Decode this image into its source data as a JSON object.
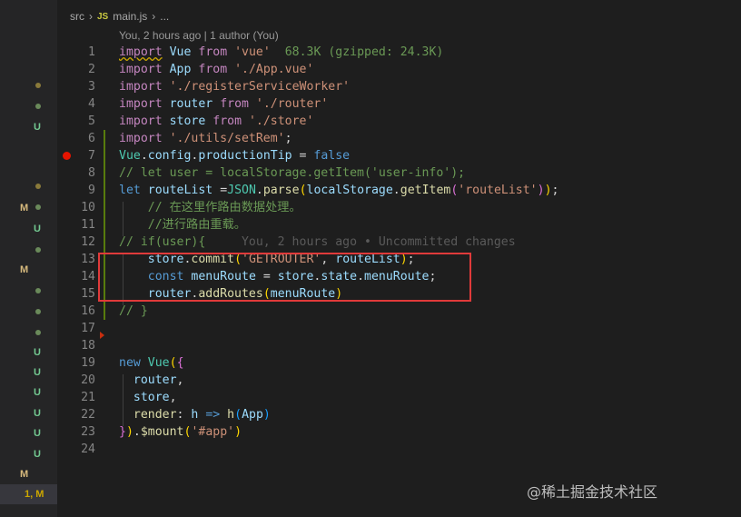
{
  "breadcrumb": {
    "folder": "src",
    "file_badge": "JS",
    "file": "main.js",
    "more": "..."
  },
  "codelens": "You, 2 hours ago | 1 author (You)",
  "watermark": "@稀土掘金技术社区",
  "scm_markers": [
    {
      "label": "",
      "kind": "dot",
      "color": "#8a7a3a"
    },
    {
      "label": "",
      "kind": "dot",
      "color": "#6a8a5a"
    },
    {
      "label": "U",
      "kind": "U"
    },
    {
      "label": "",
      "kind": "dot",
      "color": "#8a7a3a"
    },
    {
      "label": "",
      "kind": "dot",
      "color": "#6a8a5a"
    },
    {
      "label": "M",
      "kind": "M"
    },
    {
      "label": "U",
      "kind": "U"
    },
    {
      "label": "",
      "kind": "dot",
      "color": "#6a8a5a"
    },
    {
      "label": "M",
      "kind": "M"
    },
    {
      "label": "",
      "kind": "dot",
      "color": "#6a8a5a"
    },
    {
      "label": "",
      "kind": "dot",
      "color": "#6a8a5a"
    },
    {
      "label": "",
      "kind": "dot",
      "color": "#6a8a5a"
    },
    {
      "label": "U",
      "kind": "U"
    },
    {
      "label": "U",
      "kind": "U"
    },
    {
      "label": "U",
      "kind": "U"
    },
    {
      "label": "U",
      "kind": "U"
    },
    {
      "label": "U",
      "kind": "U"
    },
    {
      "label": "U",
      "kind": "U"
    },
    {
      "label": "M",
      "kind": "M"
    },
    {
      "label": "1, M",
      "kind": "warn"
    }
  ],
  "lines": [
    {
      "n": "1",
      "tokens": [
        [
          "kw2 squig",
          "import"
        ],
        [
          "punc",
          " "
        ],
        [
          "id",
          "Vue"
        ],
        [
          "punc",
          " "
        ],
        [
          "kw2",
          "from"
        ],
        [
          "punc",
          " "
        ],
        [
          "str",
          "'vue'"
        ],
        [
          "punc",
          "  "
        ],
        [
          "size",
          "68.3K (gzipped: 24.3K)"
        ]
      ]
    },
    {
      "n": "2",
      "tokens": [
        [
          "kw2",
          "import"
        ],
        [
          "punc",
          " "
        ],
        [
          "id",
          "App"
        ],
        [
          "punc",
          " "
        ],
        [
          "kw2",
          "from"
        ],
        [
          "punc",
          " "
        ],
        [
          "str",
          "'./App.vue'"
        ]
      ]
    },
    {
      "n": "3",
      "tokens": [
        [
          "kw2",
          "import"
        ],
        [
          "punc",
          " "
        ],
        [
          "str",
          "'./registerServiceWorker'"
        ]
      ]
    },
    {
      "n": "4",
      "tokens": [
        [
          "kw2",
          "import"
        ],
        [
          "punc",
          " "
        ],
        [
          "id",
          "router"
        ],
        [
          "punc",
          " "
        ],
        [
          "kw2",
          "from"
        ],
        [
          "punc",
          " "
        ],
        [
          "str",
          "'./router'"
        ]
      ]
    },
    {
      "n": "5",
      "tokens": [
        [
          "kw2",
          "import"
        ],
        [
          "punc",
          " "
        ],
        [
          "id",
          "store"
        ],
        [
          "punc",
          " "
        ],
        [
          "kw2",
          "from"
        ],
        [
          "punc",
          " "
        ],
        [
          "str",
          "'./store'"
        ]
      ]
    },
    {
      "n": "6",
      "tokens": [
        [
          "kw2",
          "import"
        ],
        [
          "punc",
          " "
        ],
        [
          "str",
          "'./utils/setRem'"
        ],
        [
          "punc",
          ";"
        ]
      ]
    },
    {
      "n": "7",
      "tokens": [
        [
          "cls",
          "Vue"
        ],
        [
          "punc",
          "."
        ],
        [
          "id",
          "config"
        ],
        [
          "punc",
          "."
        ],
        [
          "id",
          "productionTip"
        ],
        [
          "punc",
          " = "
        ],
        [
          "kw",
          "false"
        ]
      ]
    },
    {
      "n": "8",
      "tokens": [
        [
          "cmt",
          "// let user = localStorage.getItem('user-info');"
        ]
      ]
    },
    {
      "n": "9",
      "tokens": [
        [
          "kw",
          "let"
        ],
        [
          "punc",
          " "
        ],
        [
          "id",
          "routeList"
        ],
        [
          "punc",
          " ="
        ],
        [
          "cls",
          "JSON"
        ],
        [
          "punc",
          "."
        ],
        [
          "fn",
          "parse"
        ],
        [
          "br",
          "("
        ],
        [
          "id",
          "localStorage"
        ],
        [
          "punc",
          "."
        ],
        [
          "fn",
          "getItem"
        ],
        [
          "br2",
          "("
        ],
        [
          "str",
          "'routeList'"
        ],
        [
          "br2",
          ")"
        ],
        [
          "br",
          ")"
        ],
        [
          "punc",
          ";"
        ]
      ]
    },
    {
      "n": "10",
      "tokens": [
        [
          "punc",
          "    "
        ],
        [
          "cmt",
          "// 在这里作路由数据处理。"
        ]
      ]
    },
    {
      "n": "11",
      "tokens": [
        [
          "punc",
          "    "
        ],
        [
          "cmt",
          "//进行路由重载。"
        ]
      ]
    },
    {
      "n": "12",
      "tokens": [
        [
          "cmt",
          "// if(user){"
        ],
        [
          "punc",
          "     "
        ],
        [
          "blame",
          "You, 2 hours ago • Uncommitted changes"
        ]
      ]
    },
    {
      "n": "13",
      "tokens": [
        [
          "punc",
          "    "
        ],
        [
          "id",
          "store"
        ],
        [
          "punc",
          "."
        ],
        [
          "fn",
          "commit"
        ],
        [
          "br",
          "("
        ],
        [
          "str",
          "'GETROUTER'"
        ],
        [
          "punc",
          ", "
        ],
        [
          "id",
          "routeList"
        ],
        [
          "br",
          ")"
        ],
        [
          "punc",
          ";"
        ]
      ]
    },
    {
      "n": "14",
      "tokens": [
        [
          "punc",
          "    "
        ],
        [
          "kw",
          "const"
        ],
        [
          "punc",
          " "
        ],
        [
          "id",
          "menuRoute"
        ],
        [
          "punc",
          " = "
        ],
        [
          "id",
          "store"
        ],
        [
          "punc",
          "."
        ],
        [
          "id",
          "state"
        ],
        [
          "punc",
          "."
        ],
        [
          "id",
          "menuRoute"
        ],
        [
          "punc",
          ";"
        ]
      ]
    },
    {
      "n": "15",
      "tokens": [
        [
          "punc",
          "    "
        ],
        [
          "id",
          "router"
        ],
        [
          "punc",
          "."
        ],
        [
          "fn",
          "addRoutes"
        ],
        [
          "br",
          "("
        ],
        [
          "id",
          "menuRoute"
        ],
        [
          "br",
          ")"
        ]
      ]
    },
    {
      "n": "16",
      "tokens": [
        [
          "cmt",
          "// }"
        ]
      ]
    },
    {
      "n": "17",
      "tokens": []
    },
    {
      "n": "18",
      "tokens": []
    },
    {
      "n": "19",
      "tokens": [
        [
          "kw",
          "new"
        ],
        [
          "punc",
          " "
        ],
        [
          "cls",
          "Vue"
        ],
        [
          "br",
          "("
        ],
        [
          "br2",
          "{"
        ]
      ]
    },
    {
      "n": "20",
      "tokens": [
        [
          "punc",
          "  "
        ],
        [
          "id",
          "router"
        ],
        [
          "punc",
          ","
        ]
      ]
    },
    {
      "n": "21",
      "tokens": [
        [
          "punc",
          "  "
        ],
        [
          "id",
          "store"
        ],
        [
          "punc",
          ","
        ]
      ]
    },
    {
      "n": "22",
      "tokens": [
        [
          "punc",
          "  "
        ],
        [
          "fn",
          "render"
        ],
        [
          "punc",
          ": "
        ],
        [
          "id",
          "h"
        ],
        [
          "punc",
          " "
        ],
        [
          "kw",
          "=>"
        ],
        [
          "punc",
          " "
        ],
        [
          "fn",
          "h"
        ],
        [
          "br3",
          "("
        ],
        [
          "id",
          "App"
        ],
        [
          "br3",
          ")"
        ]
      ]
    },
    {
      "n": "23",
      "tokens": [
        [
          "br2",
          "}"
        ],
        [
          "br",
          ")"
        ],
        [
          "punc",
          "."
        ],
        [
          "fn",
          "$mount"
        ],
        [
          "br",
          "("
        ],
        [
          "str",
          "'#app'"
        ],
        [
          "br",
          ")"
        ]
      ]
    },
    {
      "n": "24",
      "tokens": []
    }
  ]
}
